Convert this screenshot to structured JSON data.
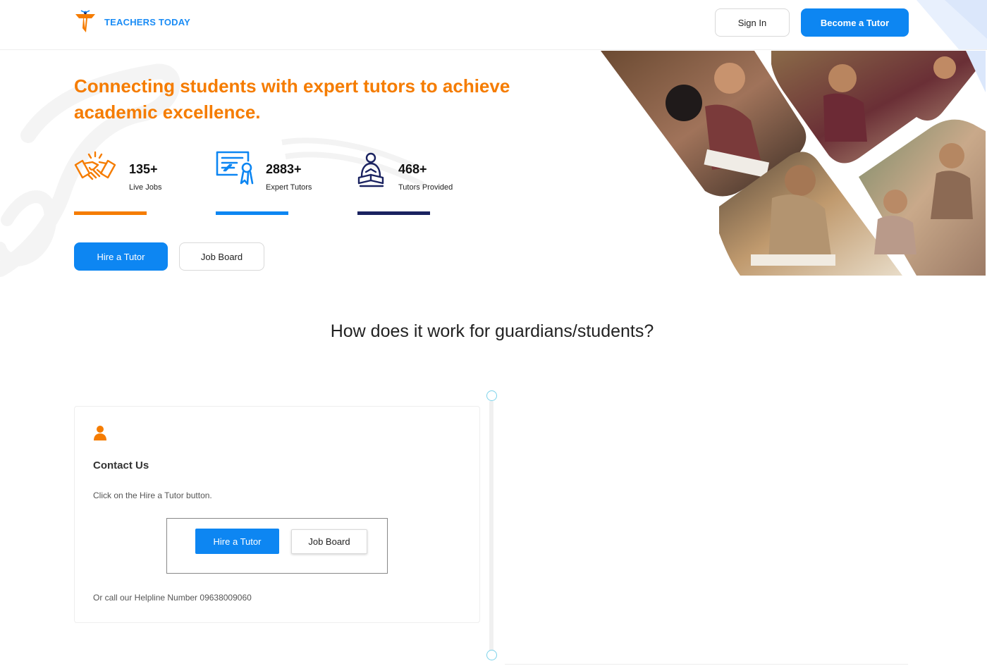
{
  "header": {
    "brand": "TEACHERS TODAY",
    "sign_in": "Sign In",
    "become_tutor": "Become a Tutor"
  },
  "hero": {
    "title": "Connecting students with expert tutors to achieve academic excellence.",
    "stats": [
      {
        "value": "135+",
        "label": "Live Jobs",
        "icon": "handshake-icon",
        "color": "#f57c00"
      },
      {
        "value": "2883+",
        "label": "Expert Tutors",
        "icon": "certificate-icon",
        "color": "#0d86f2"
      },
      {
        "value": "468+",
        "label": "Tutors Provided",
        "icon": "reader-icon",
        "color": "#1a2260"
      }
    ],
    "hire_button": "Hire a Tutor",
    "job_board_button": "Job Board"
  },
  "section": {
    "title": "How does it work for guardians/students?",
    "card": {
      "icon": "person-icon",
      "title": "Contact Us",
      "text": "Click on the Hire a Tutor button.",
      "preview_hire": "Hire a Tutor",
      "preview_job": "Job Board",
      "helpline": "Or call our Helpline Number 09638009060"
    }
  },
  "colors": {
    "accent_orange": "#f57c00",
    "primary_blue": "#0d86f2",
    "navy": "#1a2260"
  }
}
